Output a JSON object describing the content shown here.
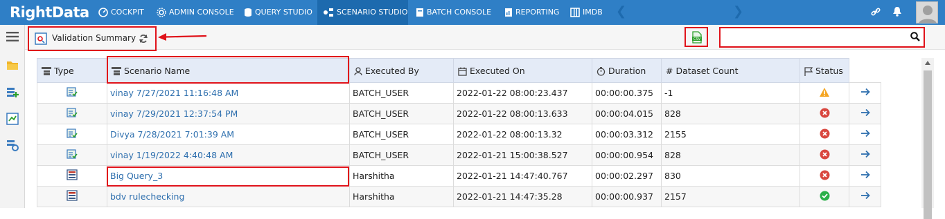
{
  "brand": {
    "name": "RightData"
  },
  "nav": {
    "items": [
      {
        "label": "COCKPIT",
        "icon": "cockpit-icon"
      },
      {
        "label": "ADMIN CONSOLE",
        "icon": "gear-icon"
      },
      {
        "label": "QUERY STUDIO",
        "icon": "database-icon"
      },
      {
        "label": "SCENARIO STUDIO",
        "icon": "scenario-icon",
        "active": true
      },
      {
        "label": "BATCH CONSOLE",
        "icon": "batch-icon"
      },
      {
        "label": "REPORTING",
        "icon": "report-icon"
      },
      {
        "label": "IMDB",
        "icon": "imdb-icon"
      }
    ]
  },
  "header": {
    "title": "Validation Summary"
  },
  "search": {
    "value": "",
    "placeholder": ""
  },
  "table": {
    "columns": [
      "Type",
      "Scenario Name",
      "Executed By",
      "Executed On",
      "Duration",
      "# Dataset Count",
      "Status"
    ],
    "rows": [
      {
        "type": "validation-icon",
        "name": "vinay 7/27/2021 11:16:48 AM",
        "by": "BATCH_USER",
        "on": "2022-01-22 08:00:23.437",
        "duration": "00:00:00.375",
        "count": "-1",
        "status": "warning"
      },
      {
        "type": "validation-icon",
        "name": "vinay 7/29/2021 12:37:54 PM",
        "by": "BATCH_USER",
        "on": "2022-01-22 08:00:13.633",
        "duration": "00:00:04.015",
        "count": "828",
        "status": "failed"
      },
      {
        "type": "validation-icon",
        "name": "Divya 7/28/2021 7:01:39 AM",
        "by": "BATCH_USER",
        "on": "2022-01-22 08:00:13.32",
        "duration": "00:00:03.312",
        "count": "2155",
        "status": "failed"
      },
      {
        "type": "validation-icon",
        "name": "vinay 1/19/2022 4:40:48 AM",
        "by": "BATCH_USER",
        "on": "2022-01-21 15:00:38.527",
        "duration": "00:00:00.954",
        "count": "828",
        "status": "failed"
      },
      {
        "type": "rule-icon",
        "name": "Big Query_3",
        "by": "Harshitha",
        "on": "2022-01-21 14:47:40.767",
        "duration": "00:00:02.297",
        "count": "830",
        "status": "failed"
      },
      {
        "type": "rule-icon",
        "name": "bdv rulechecking",
        "by": "Harshitha",
        "on": "2022-01-21 14:47:35.28",
        "duration": "00:00:00.937",
        "count": "2157",
        "status": "passed"
      }
    ]
  },
  "colors": {
    "navbar": "#2f7fc6",
    "active": "#1d6aae",
    "highlight": "#e0121a",
    "link": "#2e6fae"
  }
}
